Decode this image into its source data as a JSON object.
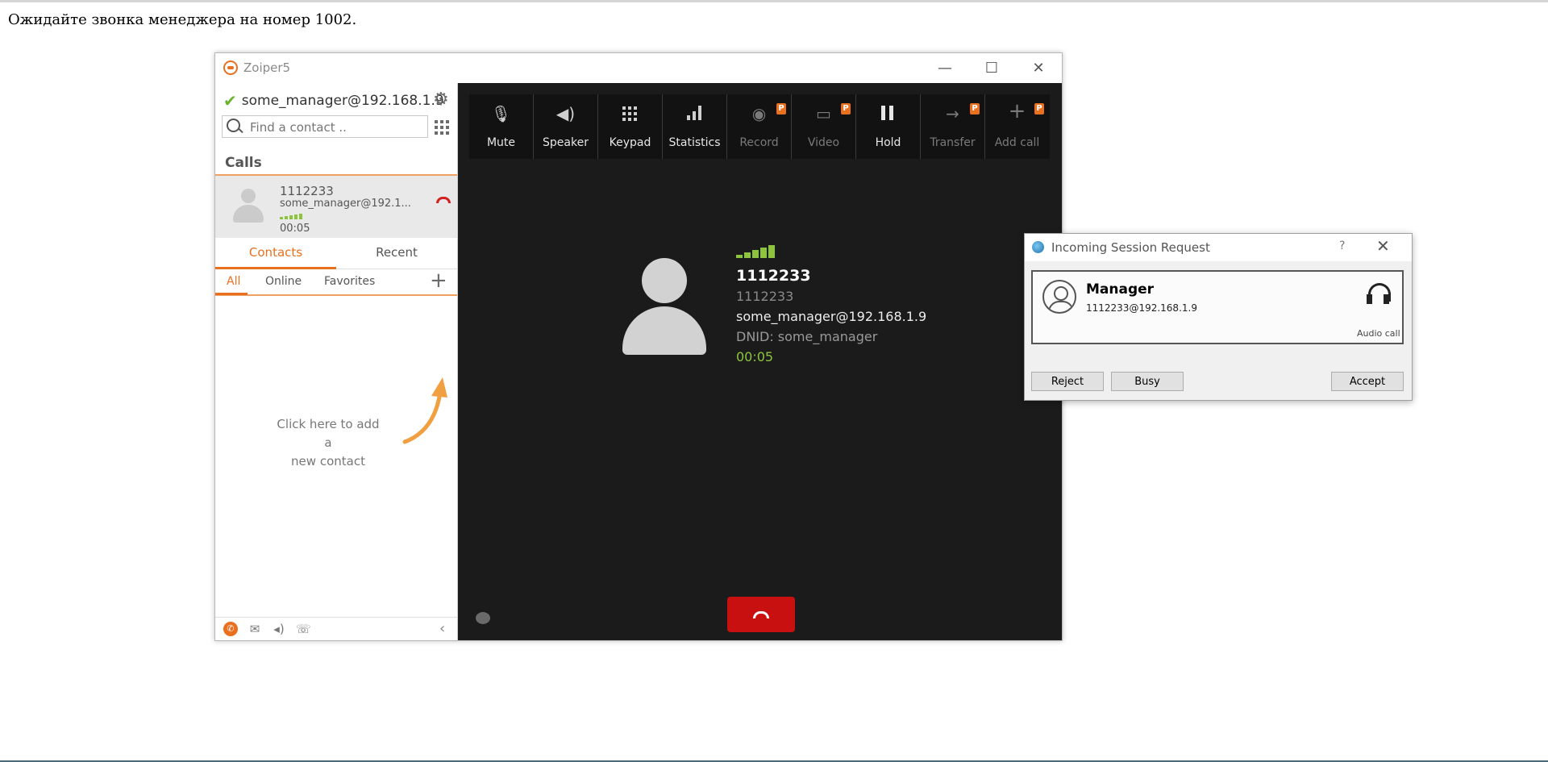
{
  "page": {
    "message": "Ожидайте звонка менеджера на номер 1002."
  },
  "zoiper": {
    "title": "Zoiper5",
    "window_buttons": {
      "minimize": "—",
      "maximize": "☐",
      "close": "✕"
    },
    "account": "some_manager@192.168.1.9",
    "search_placeholder": "Find a contact ..",
    "calls_header": "Calls",
    "call_item": {
      "number": "1112233",
      "account": "some_manager@192.1...",
      "duration": "00:05"
    },
    "tabs": [
      "Contacts",
      "Recent"
    ],
    "subtabs": [
      "All",
      "Online",
      "Favorites"
    ],
    "add_contact_hint_line1": "Click here to add a",
    "add_contact_hint_line2": "new contact",
    "toolbar": [
      {
        "label": "Mute",
        "icon": "mic-off-icon",
        "pro": false,
        "enabled": true
      },
      {
        "label": "Speaker",
        "icon": "speaker-icon",
        "pro": false,
        "enabled": true
      },
      {
        "label": "Keypad",
        "icon": "keypad-icon",
        "pro": false,
        "enabled": true
      },
      {
        "label": "Statistics",
        "icon": "statistics-icon",
        "pro": false,
        "enabled": true
      },
      {
        "label": "Record",
        "icon": "record-icon",
        "pro": true,
        "enabled": false
      },
      {
        "label": "Video",
        "icon": "video-icon",
        "pro": true,
        "enabled": false
      },
      {
        "label": "Hold",
        "icon": "pause-icon",
        "pro": false,
        "enabled": true
      },
      {
        "label": "Transfer",
        "icon": "transfer-icon",
        "pro": true,
        "enabled": false
      },
      {
        "label": "Add call",
        "icon": "plus-icon",
        "pro": true,
        "enabled": false
      }
    ],
    "pro_badge": "P",
    "active_call": {
      "name": "1112233",
      "number": "1112233",
      "uri": "some_manager@192.168.1.9",
      "dnid": "DNID: some_manager",
      "duration": "00:05"
    },
    "colors": {
      "accent": "#e8701f",
      "signal": "#8cc43c",
      "hangup": "#c81010",
      "dark_bg": "#1b1b1b"
    }
  },
  "dialog": {
    "title": "Incoming Session Request",
    "help": "?",
    "close": "✕",
    "caller_name": "Manager",
    "caller_address": "1112233@192.168.1.9",
    "call_type": "Audio call",
    "buttons": {
      "reject": "Reject",
      "busy": "Busy",
      "accept": "Accept"
    }
  }
}
